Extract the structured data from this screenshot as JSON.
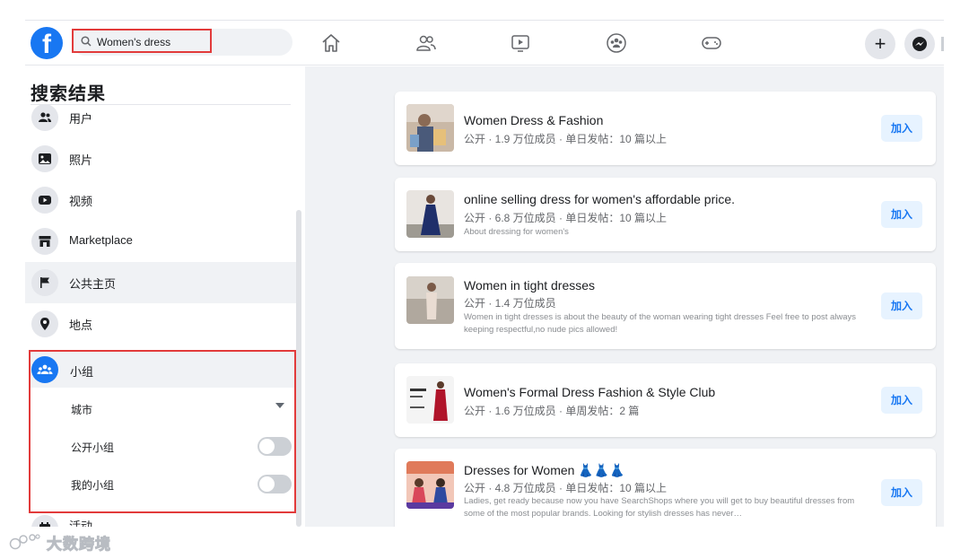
{
  "search": {
    "value": "Women's dress"
  },
  "logo": {
    "letter": "f"
  },
  "nav": {
    "icons": [
      "home-icon",
      "friends-icon",
      "watch-icon",
      "groups-icon",
      "gaming-icon"
    ],
    "create_label": "+",
    "messenger_icon": "messenger-icon"
  },
  "sidebar": {
    "title": "搜索结果",
    "items": [
      {
        "label": "用户",
        "icon": "people-icon"
      },
      {
        "label": "照片",
        "icon": "photos-icon"
      },
      {
        "label": "视频",
        "icon": "video-icon"
      },
      {
        "label": "Marketplace",
        "icon": "shop-icon"
      },
      {
        "label": "公共主页",
        "icon": "flag-icon"
      },
      {
        "label": "地点",
        "icon": "location-pin-icon"
      }
    ],
    "groups": {
      "label": "小组",
      "filters": {
        "city": "城市",
        "public_groups": "公开小组",
        "my_groups": "我的小组"
      }
    },
    "cut_item": "活动"
  },
  "results": [
    {
      "title": "Women Dress & Fashion",
      "meta": "公开 · 1.9 万位成员 · 单日发帖：10 篇以上",
      "desc": "",
      "join": "加入"
    },
    {
      "title": "online selling dress for women's affordable price.",
      "meta": "公开 · 6.8 万位成员 · 单日发帖：10 篇以上",
      "desc": "About dressing for women's",
      "join": "加入"
    },
    {
      "title": "Women in tight dresses",
      "meta": "公开 · 1.4 万位成员",
      "desc": "Women in tight dresses is about the beauty of the woman wearing tight dresses Feel free to post always keeping respectful,no nude pics allowed!",
      "join": "加入"
    },
    {
      "title": "Women's Formal Dress Fashion & Style Club",
      "meta": "公开 · 1.6 万位成员 · 单周发帖：2 篇",
      "desc": "",
      "join": "加入"
    },
    {
      "title": "Dresses for Women 👗👗👗",
      "meta": "公开 · 4.8 万位成员 · 单日发帖：10 篇以上",
      "desc": "Ladies, get ready because now you have SearchShops where you will get to buy beautiful dresses from some of the most popular brands. Looking for stylish dresses has never…",
      "join": "加入"
    }
  ],
  "watermark": {
    "text": "大数跨境"
  },
  "colors": {
    "brand": "#1877f2",
    "highlight": "#e23b3b",
    "background": "#f0f2f5"
  }
}
